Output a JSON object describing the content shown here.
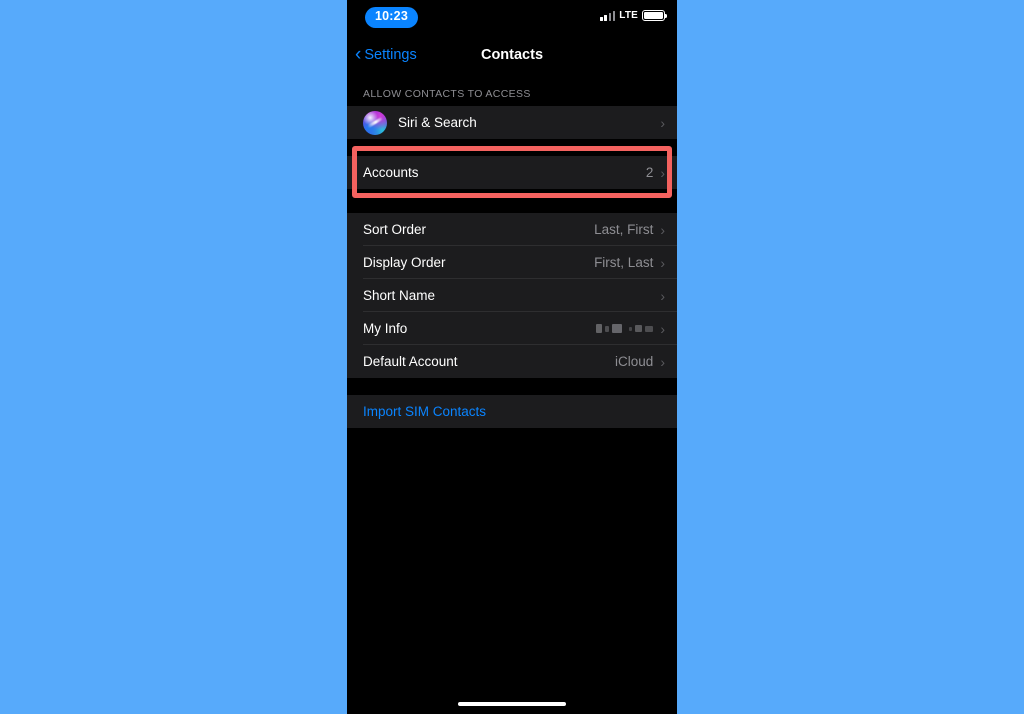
{
  "background_color": "#57aafb",
  "status_bar": {
    "time": "10:23",
    "time_pill_color": "#0a84ff",
    "carrier_network": "LTE",
    "signal_icon": "cellular-signal-icon",
    "battery_icon": "battery-icon"
  },
  "nav_bar": {
    "back_label": "Settings",
    "back_icon": "chevron-left-icon",
    "title": "Contacts",
    "accent_color": "#0a84ff"
  },
  "sections": [
    {
      "header": "ALLOW CONTACTS TO ACCESS",
      "rows": [
        {
          "label": "Siri & Search",
          "value": "",
          "icon": "siri-icon",
          "chevron": "›"
        }
      ]
    },
    {
      "header": "",
      "rows": [
        {
          "label": "Accounts",
          "value": "2",
          "chevron": "›",
          "highlighted": true,
          "highlight_color": "#f4625f"
        }
      ]
    },
    {
      "header": "",
      "rows": [
        {
          "label": "Sort Order",
          "value": "Last, First",
          "chevron": "›"
        },
        {
          "label": "Display Order",
          "value": "First, Last",
          "chevron": "›"
        },
        {
          "label": "Short Name",
          "value": "",
          "chevron": "›"
        },
        {
          "label": "My Info",
          "value": "",
          "value_redacted": true,
          "chevron": "›"
        },
        {
          "label": "Default Account",
          "value": "iCloud",
          "chevron": "›"
        }
      ]
    },
    {
      "header": "",
      "rows": [
        {
          "label": "Import SIM Contacts",
          "value": "",
          "is_link": true
        }
      ]
    }
  ],
  "home_indicator": "home-indicator"
}
